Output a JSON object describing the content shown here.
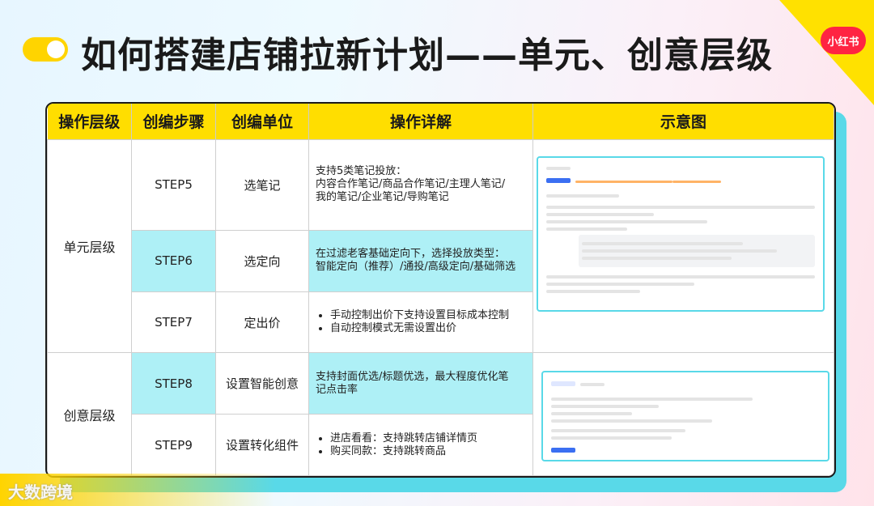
{
  "header": {
    "title": "如何搭建店铺拉新计划——单元、创意层级",
    "brand_badge": "小红书"
  },
  "table": {
    "headers": [
      "操作层级",
      "创编步骤",
      "创编单位",
      "操作详解",
      "示意图"
    ],
    "levels": [
      "单元层级",
      "创意层级"
    ],
    "rows": [
      {
        "step": "STEP5",
        "unit": "选笔记",
        "detail_lines": [
          "支持5类笔记投放：",
          "内容合作笔记/商品合作笔记/主理人笔记/",
          "我的笔记/企业笔记/导购笔记"
        ]
      },
      {
        "step": "STEP6",
        "unit": "选定向",
        "detail_lines": [
          "在过滤老客基础定向下，选择投放类型：",
          "智能定向（推荐）/通投/高级定向/基础筛选"
        ]
      },
      {
        "step": "STEP7",
        "unit": "定出价",
        "bullets": [
          "手动控制出价下支持设置目标成本控制",
          "自动控制模式无需设置出价"
        ]
      },
      {
        "step": "STEP8",
        "unit": "设置智能创意",
        "detail_lines": [
          "支持封面优选/标题优选，最大程度优化笔",
          "记点击率"
        ]
      },
      {
        "step": "STEP9",
        "unit": "设置转化组件",
        "bullets": [
          "进店看看：支持跳转店铺详情页",
          "购买同款：支持跳转商品"
        ]
      }
    ]
  },
  "footer": {
    "logo_text": "大数跨境"
  },
  "colors": {
    "header_yellow": "#ffde00",
    "highlight_cyan": "#aef0f6",
    "accent_cyan": "#59d9e8",
    "brand_red": "#ff2442"
  }
}
